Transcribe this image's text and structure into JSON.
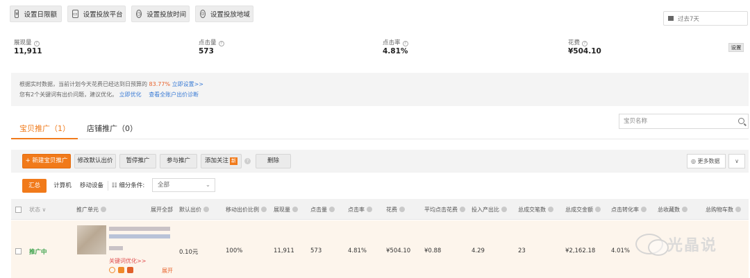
{
  "top_buttons": [
    {
      "label": "设置日限额",
      "icon": "budget-icon"
    },
    {
      "label": "设置投放平台",
      "icon": "platform-icon"
    },
    {
      "label": "设置投放时间",
      "icon": "clock-icon"
    },
    {
      "label": "设置投放地域",
      "icon": "location-icon"
    }
  ],
  "date_range": {
    "label": "过去7天",
    "icon": "calendar-icon"
  },
  "stats": [
    {
      "label": "展现量",
      "value": "11,911"
    },
    {
      "label": "点击量",
      "value": "573"
    },
    {
      "label": "点击率",
      "value": "4.81%"
    },
    {
      "label": "花费",
      "value": "¥504.10"
    }
  ],
  "stats_setting_label": "设置",
  "notice": {
    "line1_prefix": "根据实时数据，当前计划今天花费已经达到日预算的",
    "line1_pct": "83.77%",
    "line1_link": "立即设置>>",
    "line2_prefix": "您有2个关键词有出价问题，建议优化。",
    "line2_link1": "立即优化",
    "line2_link2": "查看全账户出价诊断"
  },
  "tabs": [
    {
      "label": "宝贝推广（1）",
      "active": true
    },
    {
      "label": "店铺推广（0）",
      "active": false
    }
  ],
  "search": {
    "placeholder": "宝贝名称"
  },
  "actions": {
    "new": "+ 新建宝贝推广",
    "modify_bid": "修改默认出价",
    "pause": "暂停推广",
    "join": "参与推广",
    "follow": "添加关注",
    "follow_badge": "新",
    "delete": "删除",
    "more_data": "更多数据"
  },
  "filters": {
    "summary": "汇总",
    "computer": "计算机",
    "mobile": "移动设备",
    "detail_label": "细分条件:",
    "detail_value": "全部"
  },
  "table": {
    "headers": {
      "status": "状态",
      "unit": "推广单元",
      "expand_all": "展开全部",
      "default_bid": "默认出价",
      "mobile_ratio": "移动出价比例",
      "impressions": "展现量",
      "clicks": "点击量",
      "ctr": "点击率",
      "cost": "花费",
      "avg_cpc": "平均点击花费",
      "roi": "投入产出比",
      "orders": "总成交笔数",
      "gmv": "总成交金额",
      "cvr": "点击转化率",
      "favorites": "总收藏数",
      "cart": "总购物车数"
    },
    "row": {
      "status": "推广中",
      "keyword_link": "关键词优化>>",
      "expand": "展开",
      "default_bid": "0.10元",
      "mobile_ratio": "100%",
      "impressions": "11,911",
      "clicks": "573",
      "ctr": "4.81%",
      "cost": "¥504.10",
      "avg_cpc": "¥0.88",
      "roi": "4.29",
      "orders": "23",
      "gmv": "¥2,162.18",
      "cvr": "4.01%"
    }
  },
  "watermark": "光晶说",
  "colors": {
    "accent": "#f17a1a",
    "link": "#3a7bd5",
    "status_active": "#3aa14a",
    "warn_text": "#e04d4d"
  }
}
